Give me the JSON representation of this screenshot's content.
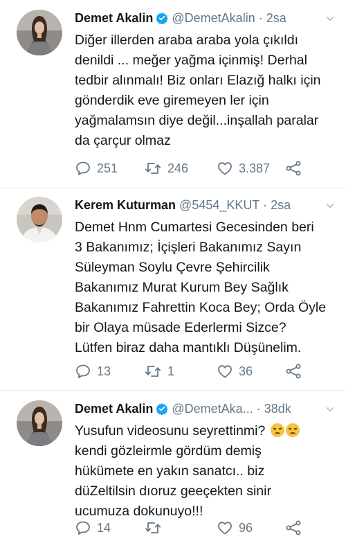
{
  "tweets": [
    {
      "name": "Demet Akalin",
      "handle": "@DemetAkalin",
      "dot": "·",
      "time": "2sa",
      "verified": true,
      "avatar": "woman-avatar",
      "body": "Diğer illerden araba araba yola çıkıldı\ndenildi ... meğer yağma içinmiş! Derhal\ntedbir alınmalı! Biz onları Elazığ halkı için\ngönderdik eve giremeyen ler için\nyağmalamsın diye değil...inşallah paralar\nda çarçur olmaz",
      "replies": "251",
      "retweets": "246",
      "likes": "3.387"
    },
    {
      "name": "Kerem Kuturman",
      "handle": "@5454_KKUT",
      "dot": "·",
      "time": "2sa",
      "verified": false,
      "avatar": "man-avatar",
      "body": "Demet Hnm Cumartesi Gecesinden beri\n3 Bakanımız; İçişleri Bakanımız Sayın\nSüleyman Soylu Çevre Şehircilik\nBakanımız Murat Kurum Bey Sağlık\nBakanımız Fahrettin Koca Bey; Orda Öyle\nbir Olaya müsade Ederlermi Sizce?\nLütfen biraz daha mantıklı Düşünelim.",
      "replies": "13",
      "retweets": "1",
      "likes": "36"
    },
    {
      "name": "Demet Akalin",
      "handle": "@DemetAka...",
      "dot": "·",
      "time": "38dk",
      "verified": true,
      "avatar": "woman-avatar",
      "body_line1": "Yusufun videosunu seyrettinmi?",
      "body_rest": "kendi gözleirmle gördüm demiş\nhükümete en yakın sanatcı.. biz\ndüZeltilsin dıoruz geeçekten sinir\nucumuza dokunuyo!!!",
      "emoji": "disappointed-face-emoji",
      "replies": "14",
      "retweets": "",
      "likes": "96"
    }
  ],
  "colors": {
    "verified": "#1da1f2",
    "muted": "#657786",
    "text": "#14171a",
    "divider": "#e6ecf0"
  }
}
